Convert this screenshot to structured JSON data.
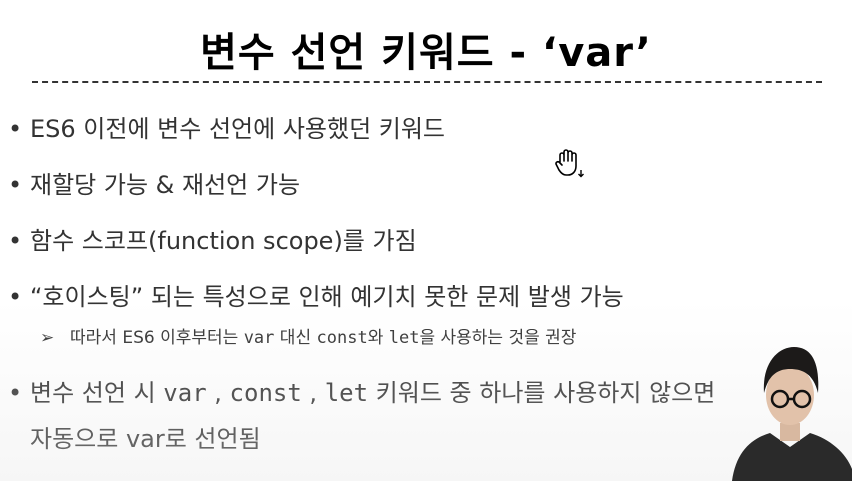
{
  "slide": {
    "title": "변수 선언 키워드 - ‘var’",
    "bullets": [
      {
        "dot": "•",
        "text": "ES6 이전에 변수 선언에 사용했던 키워드"
      },
      {
        "dot": "•",
        "text": "재할당 가능 & 재선언 가능"
      },
      {
        "dot": "•",
        "text": "함수 스코프(function scope)를 가짐"
      },
      {
        "dot": "•",
        "text": "“호이스팅” 되는 특성으로 인해 예기치 못한 문제 발생 가능"
      }
    ],
    "sub_bullet": {
      "arrow": "➢",
      "pre": "따라서 ES6 이후부터는 ",
      "code1": "var",
      "mid1": " 대신 ",
      "code2": "const",
      "mid2": "와 ",
      "code3": "let",
      "post": "을 사용하는 것을 권장"
    },
    "last_bullet": {
      "dot": "•",
      "pre": "변수 선언 시 ",
      "code1": "var",
      "sep1": " , ",
      "code2": "const",
      "sep2": " , ",
      "code3": "let",
      "post": " 키워드 중 하나를 사용하지 않으면",
      "line2_code": "자동으로 var로 선언됨"
    }
  },
  "icons": {
    "cursor": "grab-hand-cursor-icon"
  },
  "colors": {
    "text": "#333333",
    "title": "#000000",
    "background": "#ffffff"
  }
}
